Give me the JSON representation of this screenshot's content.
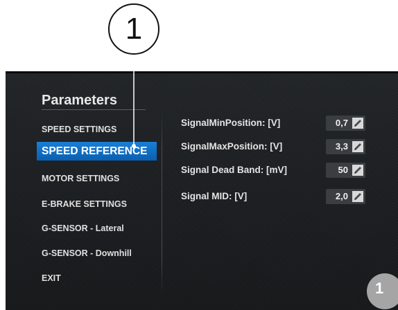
{
  "callout": {
    "number": "1"
  },
  "badge": {
    "number": "1"
  },
  "colors": {
    "accent": "#1a7fd6",
    "screen_bg": "#1b1d20",
    "value_box": "#3a3d41",
    "text": "#e4e4e4",
    "badge": "#a5a5a5"
  },
  "sidebar": {
    "title": "Parameters",
    "items": [
      {
        "label": "SPEED SETTINGS",
        "active": false
      },
      {
        "label": "SPEED REFERENCE",
        "active": true
      },
      {
        "label": "MOTOR SETTINGS",
        "active": false
      },
      {
        "label": "E-BRAKE SETTINGS",
        "active": false
      },
      {
        "label": "G-SENSOR - Lateral",
        "active": false
      },
      {
        "label": "G-SENSOR - Downhill",
        "active": false
      },
      {
        "label": "EXIT",
        "active": false
      }
    ]
  },
  "params": [
    {
      "label": "SignalMinPosition: [V]",
      "value": "0,7",
      "icon": "pencil-icon"
    },
    {
      "label": "SignalMaxPosition: [V]",
      "value": "3,3",
      "icon": "pencil-icon"
    },
    {
      "label": "Signal Dead Band: [mV]",
      "value": "50",
      "icon": "pencil-icon"
    },
    {
      "label": "Signal MID: [V]",
      "value": "2,0",
      "icon": "pencil-icon"
    }
  ]
}
